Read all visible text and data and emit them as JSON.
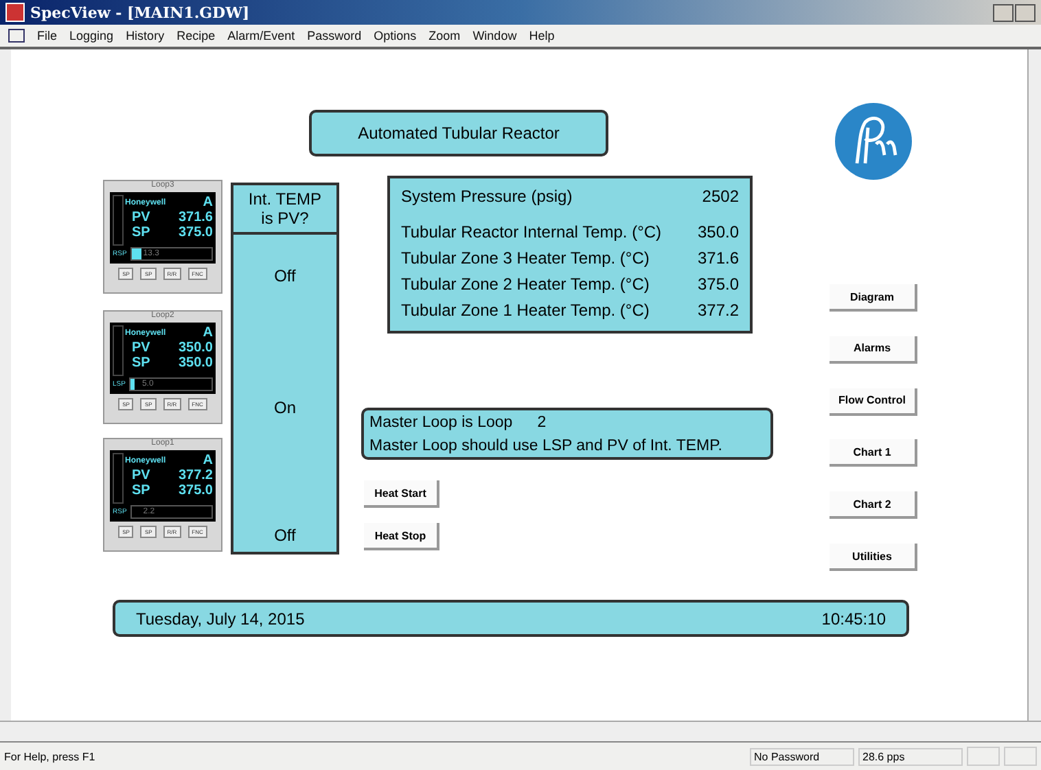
{
  "window": {
    "title": "SpecView - [MAIN1.GDW]"
  },
  "menu": [
    "File",
    "Logging",
    "History",
    "Recipe",
    "Alarm/Event",
    "Password",
    "Options",
    "Zoom",
    "Window",
    "Help"
  ],
  "screen_title": "Automated Tubular Reactor",
  "controllers": [
    {
      "label": "Loop3",
      "brand": "Honeywell",
      "mode": "A",
      "pv_label": "PV",
      "pv": "371.6",
      "sp_label": "SP",
      "sp": "375.0",
      "sp_source": "RSP",
      "output": "13.3",
      "level": 0.12,
      "keys": [
        "SP",
        "SP",
        "R/R",
        "FNC"
      ]
    },
    {
      "label": "Loop2",
      "brand": "Honeywell",
      "mode": "A",
      "pv_label": "PV",
      "pv": "350.0",
      "sp_label": "SP",
      "sp": "350.0",
      "sp_source": "LSP",
      "output": "5.0",
      "level": 0.04,
      "keys": [
        "SP",
        "SP",
        "R/R",
        "FNC"
      ]
    },
    {
      "label": "Loop1",
      "brand": "Honeywell",
      "mode": "A",
      "pv_label": "PV",
      "pv": "377.2",
      "sp_label": "SP",
      "sp": "375.0",
      "sp_source": "RSP",
      "output": "2.2",
      "level": 0.0,
      "keys": [
        "SP",
        "SP",
        "R/R",
        "FNC"
      ]
    }
  ],
  "pv_column": {
    "header": "Int. TEMP is PV?",
    "states": [
      "Off",
      "On",
      "Off"
    ]
  },
  "readings": [
    {
      "label": "System Pressure (psig)",
      "value": "2502"
    },
    {
      "label": "Tubular Reactor Internal Temp. (°C)",
      "value": "350.0"
    },
    {
      "label": "Tubular Zone 3 Heater Temp. (°C)",
      "value": "371.6"
    },
    {
      "label": "Tubular Zone 2 Heater Temp. (°C)",
      "value": "375.0"
    },
    {
      "label": "Tubular Zone 1 Heater Temp. (°C)",
      "value": "377.2"
    }
  ],
  "master_loop": {
    "label": "Master Loop is Loop",
    "loop": "2",
    "note": "Master Loop should use LSP and PV of Int. TEMP."
  },
  "heat_buttons": [
    "Heat Start",
    "Heat Stop"
  ],
  "nav_buttons": [
    "Diagram",
    "Alarms",
    "Flow Control",
    "Chart 1",
    "Chart 2",
    "Utilities"
  ],
  "date_bar": {
    "date": "Tuesday, July 14, 2015",
    "time": "10:45:10"
  },
  "status_bar": {
    "help": "For Help, press F1",
    "password": "No Password",
    "rate": "28.6 pps"
  }
}
